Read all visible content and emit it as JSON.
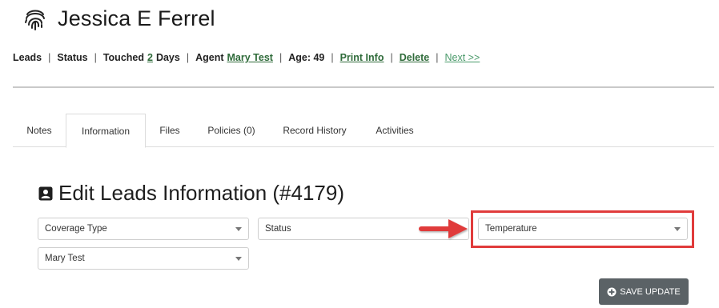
{
  "header": {
    "name": "Jessica E Ferrel",
    "icon": "fingerprint-icon"
  },
  "infobar": {
    "leads": "Leads",
    "status": "Status",
    "touched_prefix": "Touched",
    "touched_count": "2",
    "touched_suffix": "Days",
    "agent_label": "Agent",
    "agent_name": "Mary Test",
    "age": "Age: 49",
    "print_info": "Print Info",
    "delete": "Delete",
    "next": "Next >>"
  },
  "tabs": [
    {
      "label": "Notes",
      "active": false
    },
    {
      "label": "Information",
      "active": true
    },
    {
      "label": "Files",
      "active": false
    },
    {
      "label": "Policies (0)",
      "active": false
    },
    {
      "label": "Record History",
      "active": false
    },
    {
      "label": "Activities",
      "active": false
    }
  ],
  "section": {
    "title": "Edit Leads Information (#4179)",
    "icon": "contact-card-icon"
  },
  "fields": {
    "coverage_type": "Coverage Type",
    "status": "Status",
    "temperature": "Temperature",
    "agent": "Mary Test"
  },
  "save_button": {
    "label": "SAVE UPDATE",
    "icon": "plus-circle-icon"
  },
  "colors": {
    "link_green": "#2f6b3a",
    "highlight_red": "#e03b3b",
    "button_gray": "#5b6266"
  }
}
